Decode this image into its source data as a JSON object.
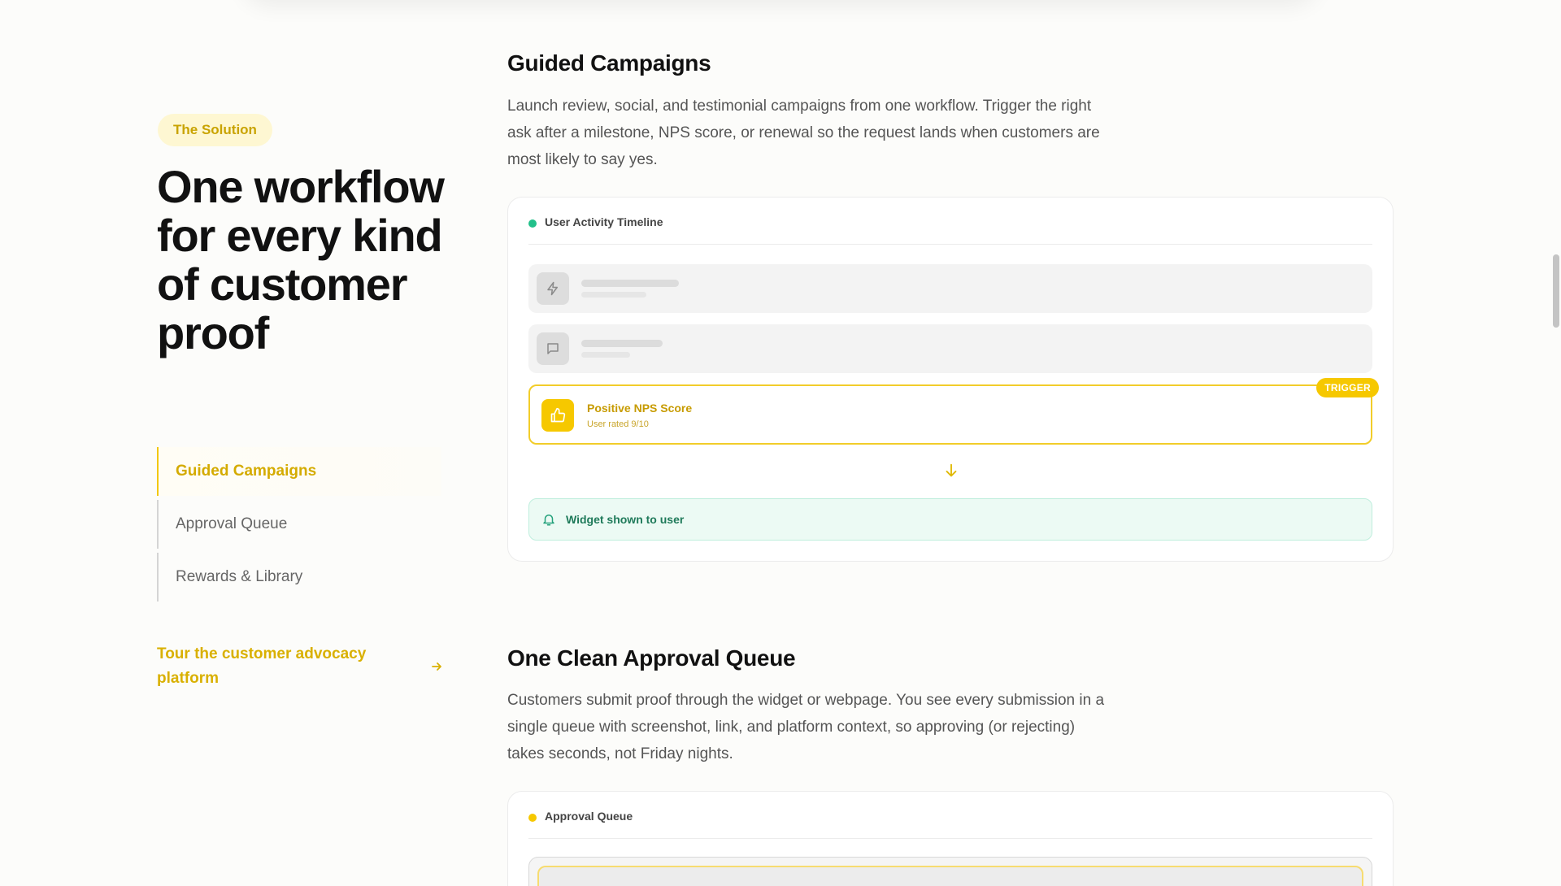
{
  "sidebar": {
    "badge": "The Solution",
    "hero_title": "One workflow for every kind of customer proof",
    "nav": [
      {
        "label": "Guided Campaigns",
        "active": true
      },
      {
        "label": "Approval Queue",
        "active": false
      },
      {
        "label": "Rewards & Library",
        "active": false
      }
    ],
    "tour_link": "Tour the customer advocacy platform"
  },
  "sections": {
    "guided": {
      "title": "Guided Campaigns",
      "description": "Launch review, social, and testimonial campaigns from one workflow. Trigger the right ask after a milestone, NPS score, or renewal so the request lands when customers are most likely to say yes.",
      "card": {
        "header": "User Activity Timeline",
        "header_dot_color": "#22c08a",
        "trigger_title": "Positive NPS Score",
        "trigger_subtitle": "User rated 9/10",
        "trigger_tag": "TRIGGER",
        "widget_label": "Widget shown to user"
      }
    },
    "approval": {
      "title": "One Clean Approval Queue",
      "description": "Customers submit proof through the widget or webpage. You see every submission in a single queue with screenshot, link, and platform context, so approving (or rejecting) takes seconds, not Friday nights.",
      "card": {
        "header": "Approval Queue",
        "header_dot_color": "#f6c800"
      }
    }
  },
  "colors": {
    "accent": "#f6c800",
    "accent_text": "#d4ab00",
    "success": "#22c08a"
  },
  "icons": {
    "row1": "lightning-icon",
    "row2": "chat-bubble-icon",
    "trigger": "thumbs-up-icon",
    "arrow": "arrow-down-icon",
    "widget": "bell-icon",
    "tour": "arrow-right-icon"
  }
}
